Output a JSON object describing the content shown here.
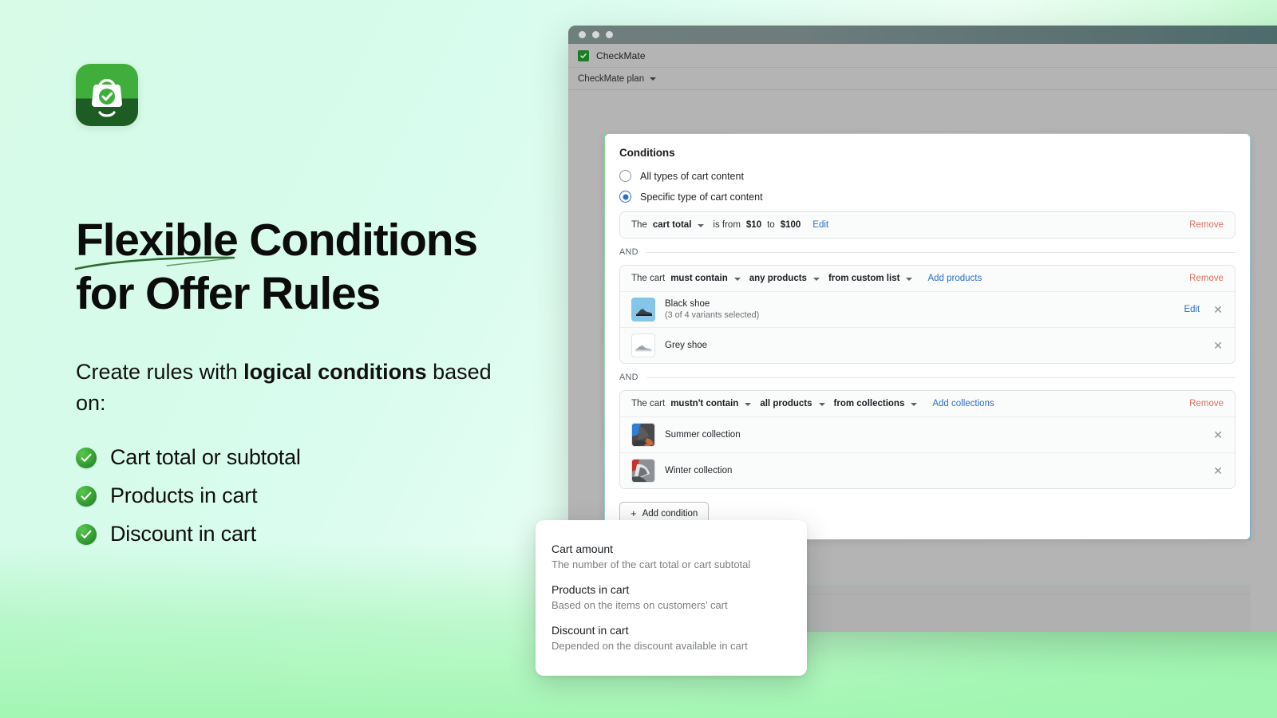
{
  "brand": {
    "logo_icon": "shopping-bag-check-icon",
    "accent_green": "#3fae3a",
    "accent_dark_green": "#1d5c22"
  },
  "hero": {
    "headline_line1": "Flexible Conditions",
    "headline_line2": "for Offer Rules",
    "underline_icon": "swoosh-underline",
    "subtext_prefix": "Create rules with ",
    "subtext_bold": "logical conditions",
    "subtext_suffix": " based on:",
    "bullets": [
      {
        "icon": "check-circle-icon",
        "label": "Cart total or subtotal"
      },
      {
        "icon": "check-circle-icon",
        "label": "Products in cart"
      },
      {
        "icon": "check-circle-icon",
        "label": "Discount in cart"
      }
    ]
  },
  "browser": {
    "traffic_lights": 3,
    "app_title": "CheckMate",
    "app_icon": "checkmate-app-icon",
    "plan_label": "CheckMate plan",
    "plan_caret_icon": "chevron-down-icon",
    "chat_icon": "chat-bubble-icon"
  },
  "conditions_card": {
    "title": "Conditions",
    "radios": [
      {
        "label": "All types of cart content",
        "selected": false
      },
      {
        "label": "Specific type of cart content",
        "selected": true
      }
    ],
    "blocks": [
      {
        "id": "cart-total",
        "prefix": "The",
        "subject": "cart total",
        "subject_caret": "chevron-down-icon",
        "middle": "is from",
        "value_from": "$10",
        "joiner": "to",
        "value_to": "$100",
        "edit_label": "Edit",
        "remove_label": "Remove",
        "items": []
      },
      {
        "id": "products-in-cart",
        "prefix": "The cart",
        "operator": "must contain",
        "quantifier": "any products",
        "source": "from custom list",
        "action_link": "Add products",
        "remove_label": "Remove",
        "items": [
          {
            "thumb": "black-shoe-thumbnail",
            "thumb_style": "blue",
            "title": "Black shoe",
            "subtitle": "(3 of 4 variants selected)",
            "edit_label": "Edit",
            "close_icon": "close-icon"
          },
          {
            "thumb": "grey-shoe-thumbnail",
            "thumb_style": "white",
            "title": "Grey shoe",
            "subtitle": "",
            "edit_label": "",
            "close_icon": "close-icon"
          }
        ]
      },
      {
        "id": "collections",
        "prefix": "The cart",
        "operator": "mustn't contain",
        "quantifier": "all products",
        "source": "from collections",
        "action_link": "Add collections",
        "remove_label": "Remove",
        "items": [
          {
            "thumb": "summer-collection-thumbnail",
            "thumb_style": "photo-summer",
            "title": "Summer collection",
            "subtitle": "",
            "edit_label": "",
            "close_icon": "close-icon"
          },
          {
            "thumb": "winter-collection-thumbnail",
            "thumb_style": "photo-winter",
            "title": "Winter collection",
            "subtitle": "",
            "edit_label": "",
            "close_icon": "close-icon"
          }
        ]
      }
    ],
    "and_label_1": "AND",
    "and_label_2": "AND",
    "add_condition_label": "Add condition",
    "add_condition_icon": "plus-icon"
  },
  "dropdown": {
    "items": [
      {
        "title": "Cart amount",
        "desc": "The number of the cart total or cart subtotal"
      },
      {
        "title": "Products in cart",
        "desc": "Based on the items on customers’ cart"
      },
      {
        "title": "Discount in cart",
        "desc": "Depended on the discount available in cart"
      }
    ]
  }
}
